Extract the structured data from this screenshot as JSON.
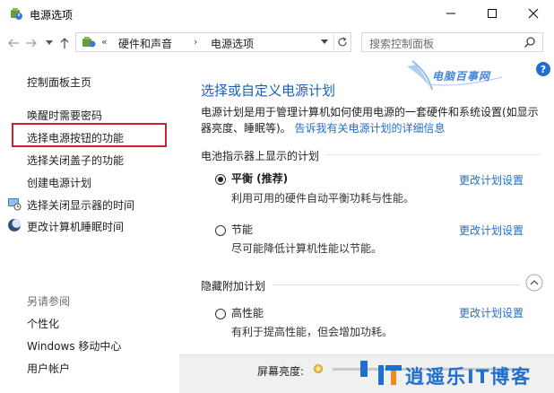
{
  "window": {
    "title": "电源选项"
  },
  "address": {
    "crumbs": [
      "硬件和声音",
      "电源选项"
    ],
    "search_placeholder": "搜索控制面板",
    "sep": "«",
    "sep_arrow": "›"
  },
  "sidebar": {
    "home": "控制面板主页",
    "items": [
      "唤醒时需要密码",
      "选择电源按钮的功能",
      "选择关闭盖子的功能",
      "创建电源计划",
      "选择关闭显示器的时间",
      "更改计算机睡眠时间"
    ],
    "see_also_title": "另请参阅",
    "see_also": [
      "个性化",
      "Windows 移动中心",
      "用户帐户"
    ]
  },
  "main": {
    "title": "选择或自定义电源计划",
    "desc": "电源计划是用于管理计算机如何使用电源的一套硬件和系统设置(如显示器亮度、睡眠等)。",
    "desc_link": "告诉我有关电源计划的详细信息",
    "group1_title": "电池指示器上显示的计划",
    "group2_title": "隐藏附加计划",
    "plans": [
      {
        "name": "平衡 (推荐)",
        "desc": "利用可用的硬件自动平衡功耗与性能。",
        "link": "更改计划设置",
        "selected": true
      },
      {
        "name": "节能",
        "desc": "尽可能降低计算机性能以节能。",
        "link": "更改计划设置",
        "selected": false
      },
      {
        "name": "高性能",
        "desc": "有利于提高性能，但会增加功耗。",
        "link": "更改计划设置",
        "selected": false
      }
    ]
  },
  "bottom": {
    "brightness_label": "屏幕亮度:",
    "brightness_level": 0.16
  },
  "watermarks": {
    "top": "电脑百事网",
    "bottom": "逍遥乐IT博客"
  },
  "colors": {
    "accent": "#1f6fce",
    "title_blue": "#1b5fb7",
    "highlight_red": "#c8232c"
  }
}
